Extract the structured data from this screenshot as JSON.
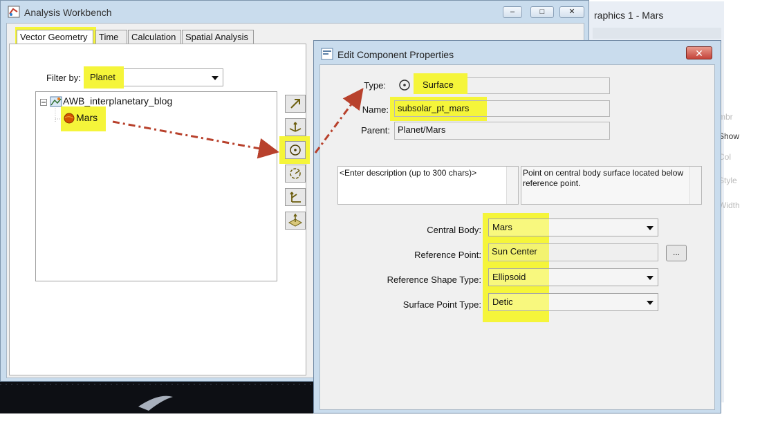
{
  "graphics_window": {
    "title": "raphics 1 - Mars",
    "side_labels": [
      "mbr",
      "Show",
      "Col",
      "Style",
      "Width"
    ]
  },
  "main_window": {
    "title": "Analysis Workbench",
    "minimize": "–",
    "maximize": "□",
    "close": "✕",
    "tabs": [
      {
        "label": "Vector Geometry",
        "active": true
      },
      {
        "label": "Time",
        "active": false
      },
      {
        "label": "Calculation",
        "active": false
      },
      {
        "label": "Spatial Analysis",
        "active": false
      }
    ],
    "filter_label": "Filter by:",
    "filter_value": "Planet",
    "tree": {
      "root": "AWB_interplanetary_blog",
      "child": "Mars"
    },
    "tool_icons": [
      "vector-icon",
      "axes-icon",
      "point-icon",
      "angle-icon",
      "system-icon",
      "plane-icon"
    ]
  },
  "dialog": {
    "title": "Edit Component Properties",
    "close": "✕",
    "type_label": "Type:",
    "type_value": "Surface",
    "name_label": "Name:",
    "name_value": "subsolar_pt_mars",
    "parent_label": "Parent:",
    "parent_value": "Planet/Mars",
    "description_placeholder": "<Enter description (up to 300 chars)>",
    "description_info": "Point on central body surface located below reference point.",
    "central_body_label": "Central Body:",
    "central_body_value": "Mars",
    "reference_point_label": "Reference Point:",
    "reference_point_value": "Sun Center",
    "reference_point_button": "...",
    "reference_shape_label": "Reference Shape Type:",
    "reference_shape_value": "Ellipsoid",
    "surface_point_label": "Surface Point Type:",
    "surface_point_value": "Detic"
  },
  "colors": {
    "highlight": "#f5f53a",
    "annotation_arrow": "#b8412c",
    "chrome": "#c9dced"
  }
}
